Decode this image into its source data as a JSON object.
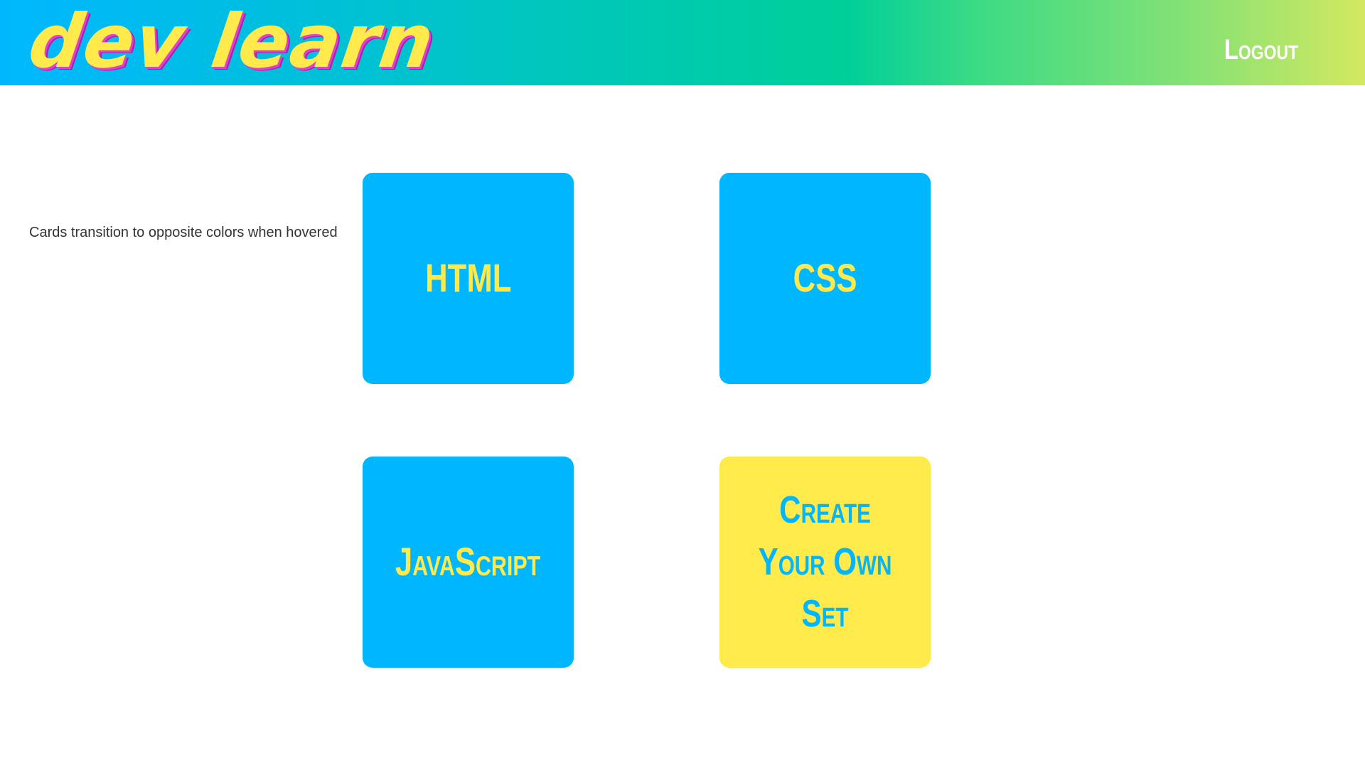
{
  "header": {
    "logo": "dev learn",
    "logout_label": "Logout"
  },
  "hint": "Cards transition to opposite colors when hovered",
  "cards": [
    {
      "label": "HTML",
      "style": "blue"
    },
    {
      "label": "CSS",
      "style": "blue"
    },
    {
      "label": "JavaScript",
      "style": "blue"
    },
    {
      "label": "Create Your Own Set",
      "style": "yellow"
    }
  ],
  "colors": {
    "card_blue": "#00b7ff",
    "card_yellow": "#ffea4c",
    "logo_yellow": "#ffe94b",
    "logo_shadow": "#e040d0"
  }
}
